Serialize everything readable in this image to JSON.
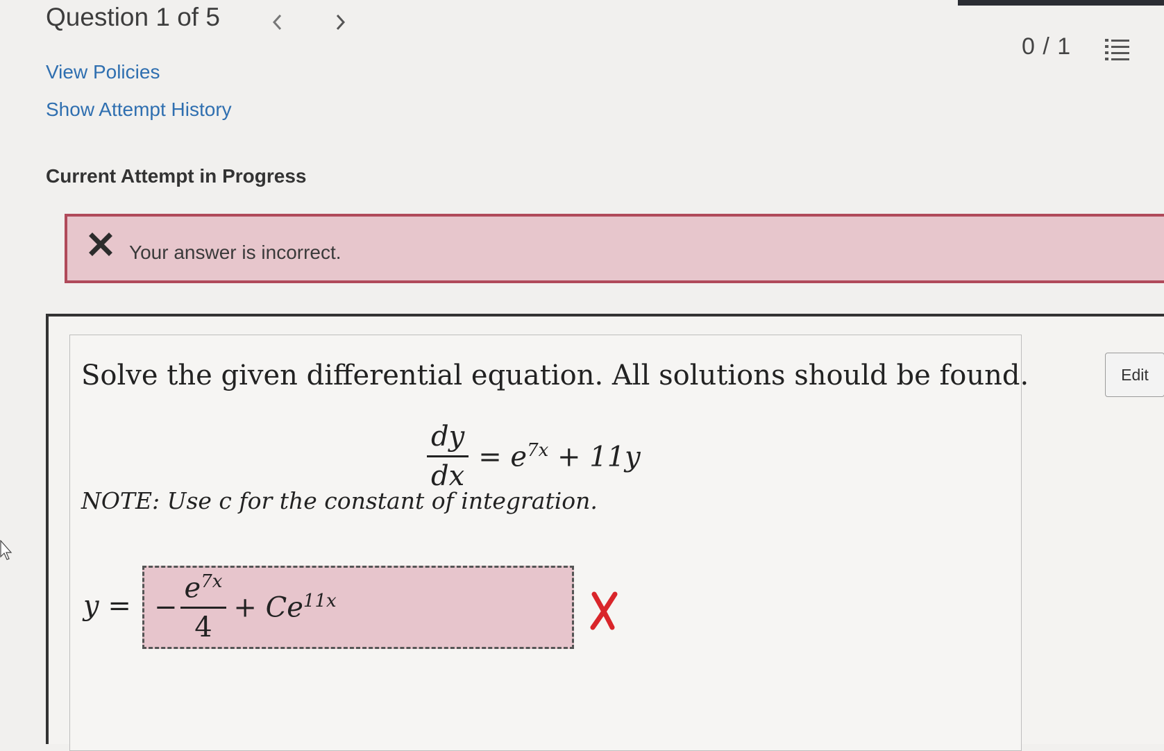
{
  "header": {
    "question_label": "Question 1 of 5",
    "score": "0 / 1",
    "prev_icon": "chevron-left-icon",
    "next_icon": "chevron-right-icon",
    "list_icon": "list-icon"
  },
  "links": {
    "view_policies": "View Policies",
    "show_attempt_history": "Show Attempt History"
  },
  "attempt_heading": "Current Attempt in Progress",
  "feedback": {
    "message": "Your answer is incorrect.",
    "icon": "x-icon",
    "color": "#b04a5a",
    "background": "#e7c6cc"
  },
  "edit_label": "Edit",
  "problem": {
    "statement": "Solve the given differential equation. All solutions should be found.",
    "equation": {
      "lhs_num": "dy",
      "lhs_den": "dx",
      "rhs_base": "= e",
      "rhs_exp": "7x",
      "rhs_rest": "+ 11y"
    },
    "note": "NOTE: Use c for the constant of integration."
  },
  "answer": {
    "lhs": "y =",
    "minus": "−",
    "frac_num_base": "e",
    "frac_num_exp": "7x",
    "frac_den": "4",
    "term_base": "+ Ce",
    "term_exp": "11x",
    "status_icon": "wrong-x-icon",
    "status_color": "#d9252a"
  }
}
